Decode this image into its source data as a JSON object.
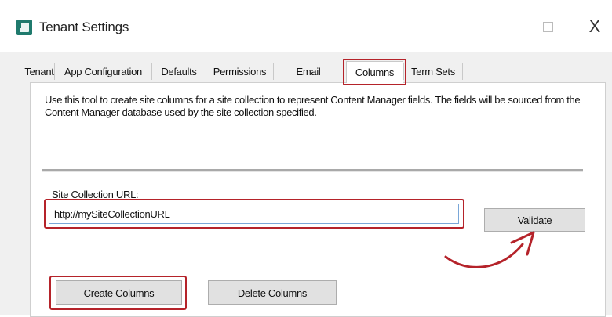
{
  "window": {
    "title": "Tenant Settings",
    "controls": {
      "minimize": "—",
      "maximize": "□",
      "close": "X"
    }
  },
  "tabs": [
    {
      "label": "Tenant"
    },
    {
      "label": "App Configuration"
    },
    {
      "label": "Defaults"
    },
    {
      "label": "Permissions"
    },
    {
      "label": "Email"
    },
    {
      "label": "Columns",
      "active": true
    },
    {
      "label": "Term Sets"
    }
  ],
  "columns_tab": {
    "description": "Use this tool to create site columns for a site collection to represent Content Manager fields.  The fields will be sourced from the Content Manager database used by the site collection specified.",
    "site_url_label": "Site Collection URL:",
    "site_url_value": "http://mySiteCollectionURL",
    "validate_label": "Validate",
    "create_columns_label": "Create Columns",
    "delete_columns_label": "Delete Columns"
  },
  "colors": {
    "highlight": "#b5232a",
    "panel_bg": "#f0f0f0",
    "button_bg": "#e1e1e1"
  },
  "icons": {
    "app": "tenant-settings-app-icon",
    "arrow": "curved-arrow-annotation"
  }
}
